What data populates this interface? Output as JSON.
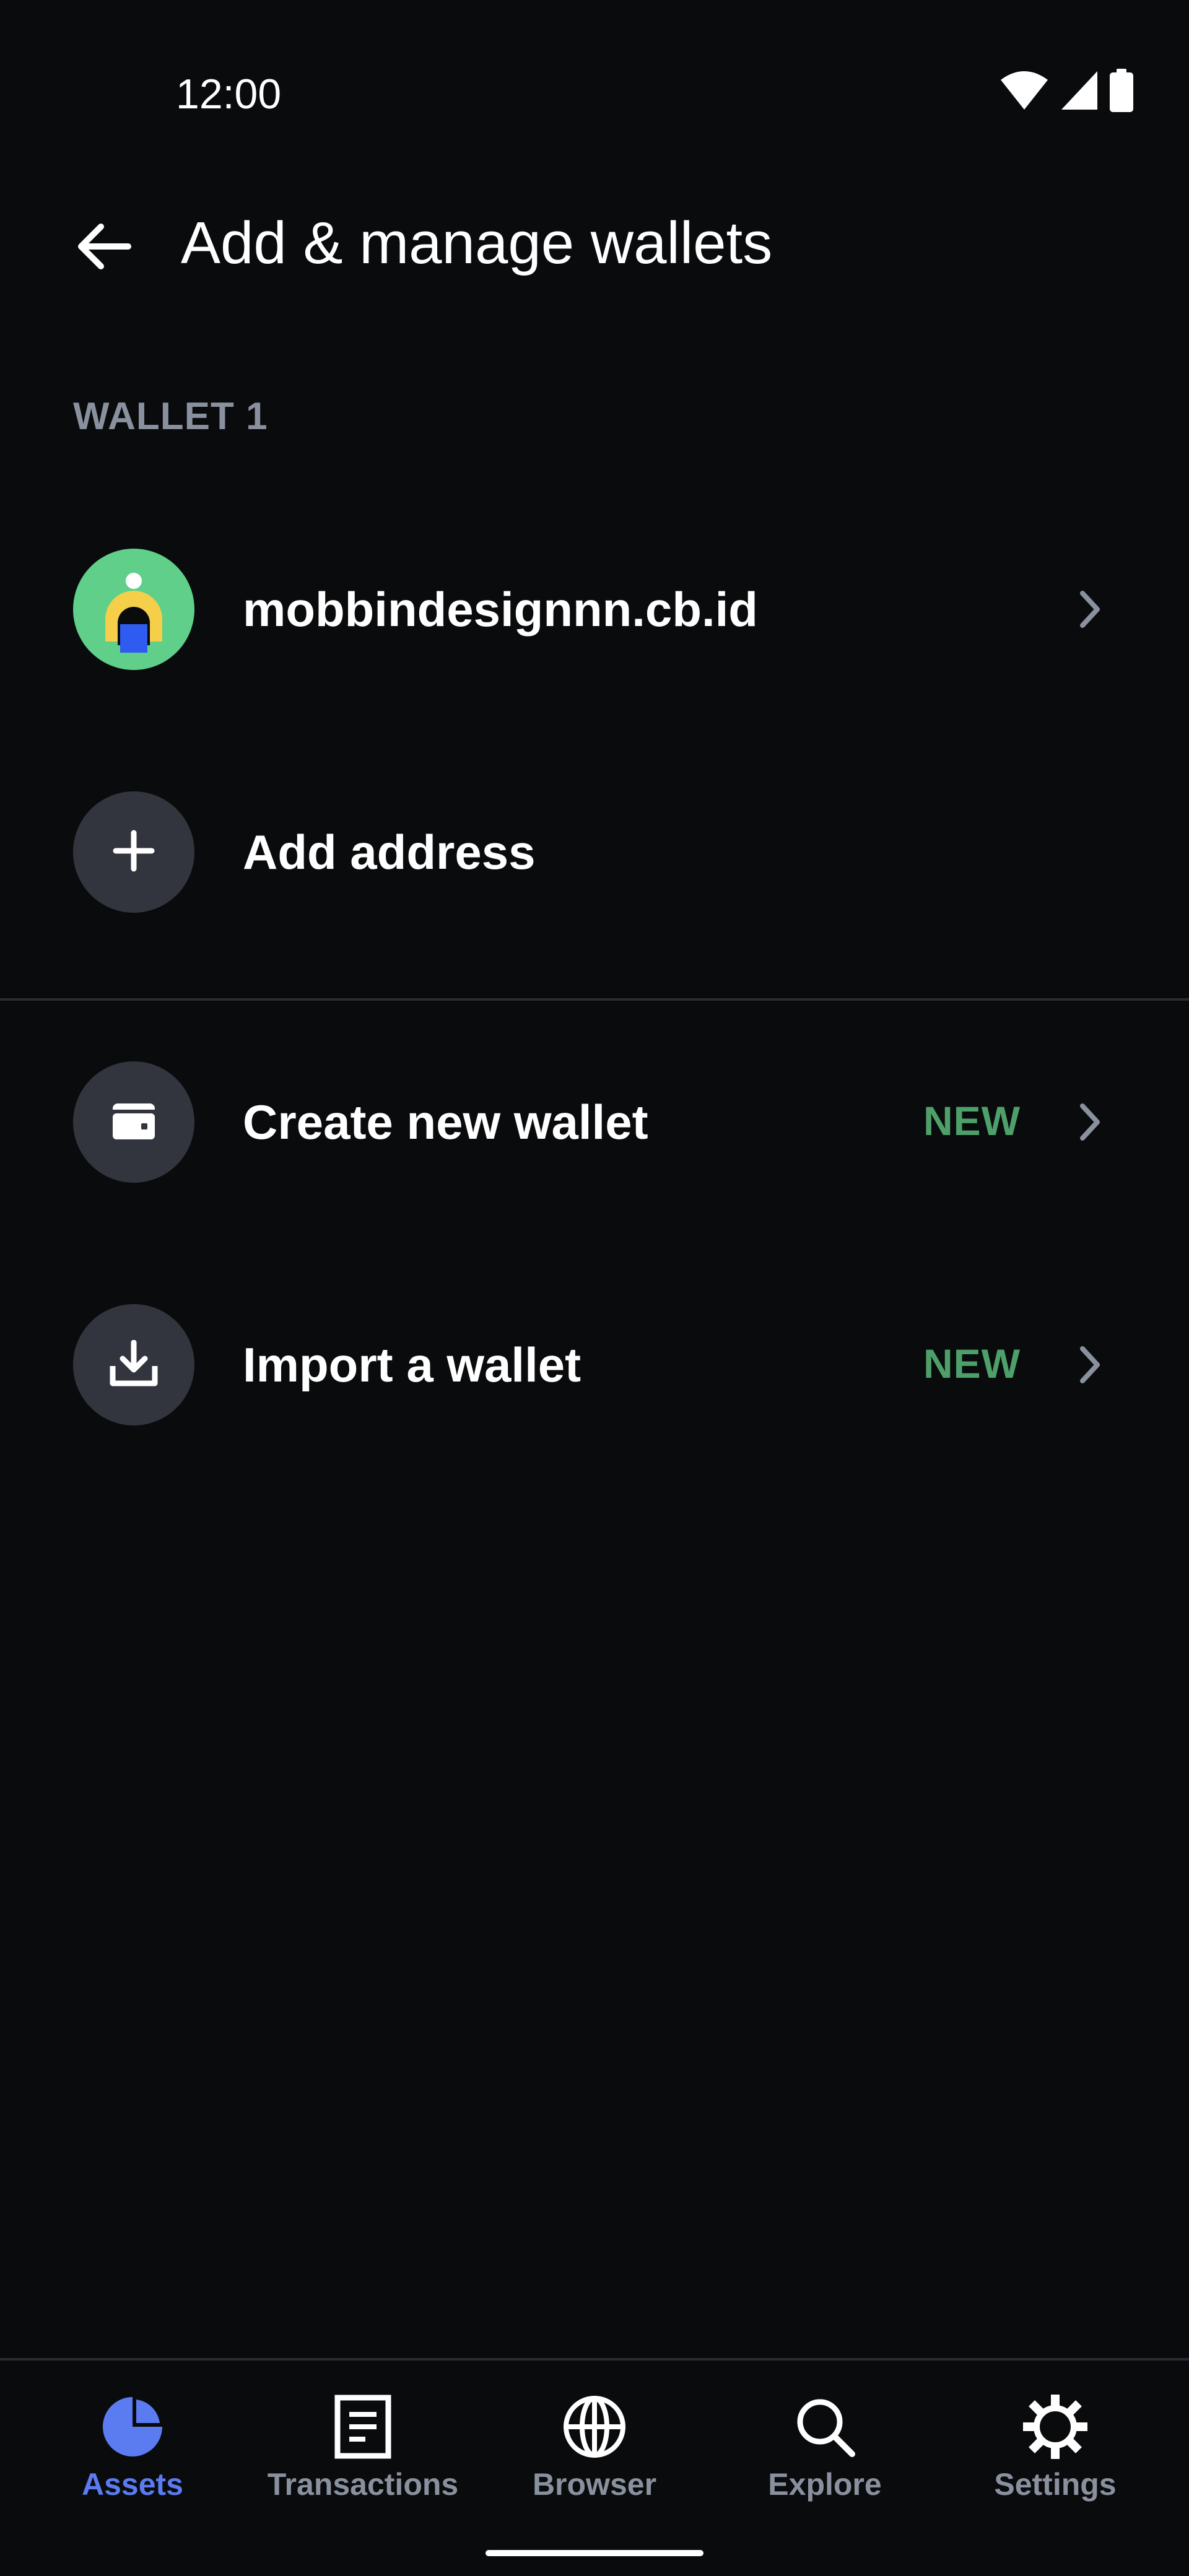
{
  "status_bar": {
    "time": "12:00",
    "icons": [
      "wifi-icon",
      "cellular-signal-icon",
      "battery-icon"
    ]
  },
  "header": {
    "back_icon": "arrow-left-icon",
    "title": "Add & manage wallets"
  },
  "wallet_section": {
    "label": "WALLET 1",
    "items": [
      {
        "label": "mobbindesignnn.cb.id",
        "icon": "avatar",
        "chevron": "chevron-right-icon"
      },
      {
        "label": "Add address",
        "icon": "plus-icon"
      }
    ]
  },
  "actions": {
    "items": [
      {
        "label": "Create new wallet",
        "badge": "NEW",
        "icon": "wallet-icon",
        "chevron": "chevron-right-icon"
      },
      {
        "label": "Import a wallet",
        "badge": "NEW",
        "icon": "download-icon",
        "chevron": "chevron-right-icon"
      }
    ]
  },
  "bottom_nav": {
    "items": [
      {
        "label": "Assets",
        "icon": "pie-chart-icon",
        "active": true
      },
      {
        "label": "Transactions",
        "icon": "document-icon",
        "active": false
      },
      {
        "label": "Browser",
        "icon": "globe-icon",
        "active": false
      },
      {
        "label": "Explore",
        "icon": "search-icon",
        "active": false
      },
      {
        "label": "Settings",
        "icon": "gear-icon",
        "active": false
      }
    ]
  },
  "colors": {
    "background": "#0a0b0d",
    "text_primary": "#ffffff",
    "text_secondary": "#8a919e",
    "accent_active": "#5b7bf0",
    "badge_new": "#4ea06a",
    "icon_circle": "#32353d",
    "avatar_bg": "#5fcf8a",
    "avatar_yellow": "#f5cf4a",
    "avatar_blue": "#2e5bf0"
  }
}
